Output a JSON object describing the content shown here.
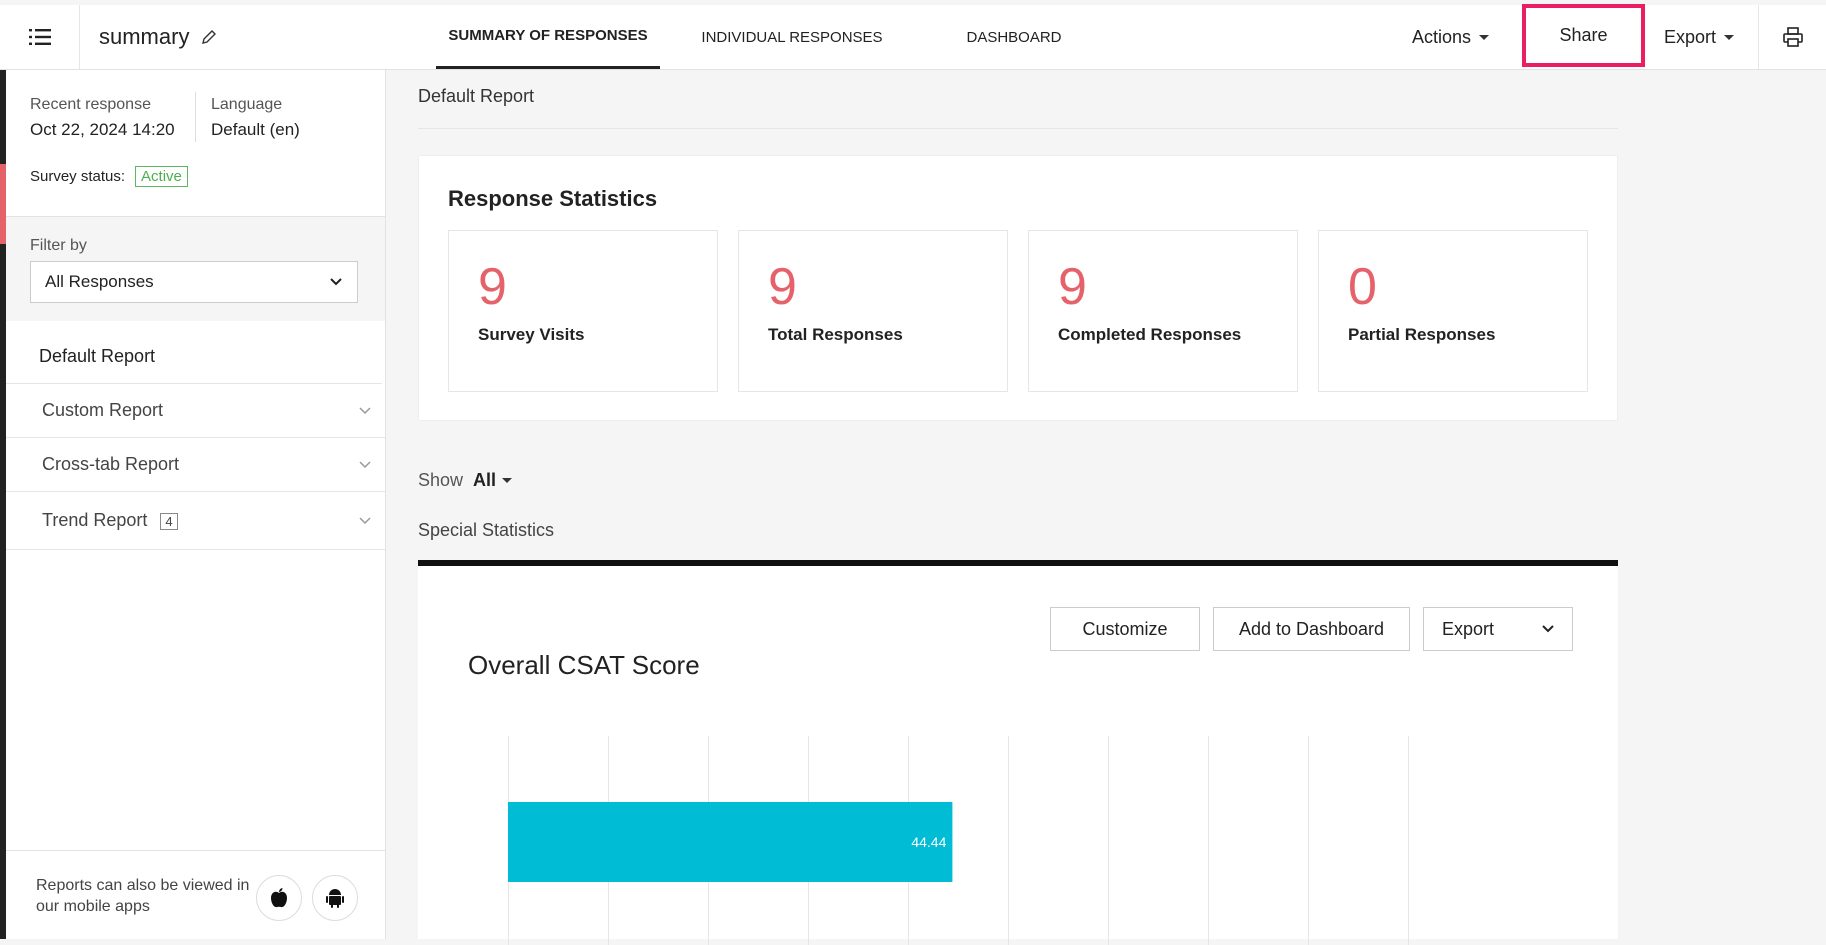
{
  "header": {
    "title": "summary",
    "tabs": [
      {
        "label": "SUMMARY OF RESPONSES",
        "active": true
      },
      {
        "label": "INDIVIDUAL RESPONSES",
        "active": false
      },
      {
        "label": "DASHBOARD",
        "active": false
      }
    ],
    "actions_label": "Actions",
    "share_label": "Share",
    "export_label": "Export",
    "icons": [
      "menu-icon",
      "pencil-icon",
      "printer-icon"
    ]
  },
  "sidebar": {
    "recent_response_label": "Recent response",
    "recent_response_value": "Oct 22, 2024 14:20",
    "language_label": "Language",
    "language_value": "Default (en)",
    "status_label": "Survey status:",
    "status_value": "Active",
    "filter_label": "Filter by",
    "filter_value": "All Responses",
    "reports": [
      {
        "label": "Default Report",
        "active": true
      },
      {
        "label": "Custom Report"
      },
      {
        "label": "Cross-tab Report"
      },
      {
        "label": "Trend Report",
        "count": "4"
      }
    ],
    "mobile_note": "Reports can also be viewed in our mobile apps"
  },
  "main": {
    "breadcrumb": "Default Report",
    "stats_title": "Response Statistics",
    "stats": [
      {
        "value": "9",
        "label": "Survey Visits"
      },
      {
        "value": "9",
        "label": "Total Responses"
      },
      {
        "value": "9",
        "label": "Completed Responses"
      },
      {
        "value": "0",
        "label": "Partial Responses"
      }
    ],
    "show_label": "Show",
    "show_value": "All",
    "special_label": "Special Statistics",
    "customize_label": "Customize",
    "add_dashboard_label": "Add to Dashboard",
    "export_label": "Export"
  },
  "colors": {
    "accent": "#e5626a",
    "bar": "#00bcd4",
    "share_border": "#ea1f62",
    "active_badge": "#4caf50"
  },
  "chart_data": {
    "type": "bar",
    "title": "Overall CSAT Score",
    "orientation": "horizontal",
    "categories": [
      ""
    ],
    "values": [
      44.44
    ],
    "data_labels": [
      "44.44"
    ],
    "xlim": [
      0,
      100
    ],
    "grid": true
  }
}
